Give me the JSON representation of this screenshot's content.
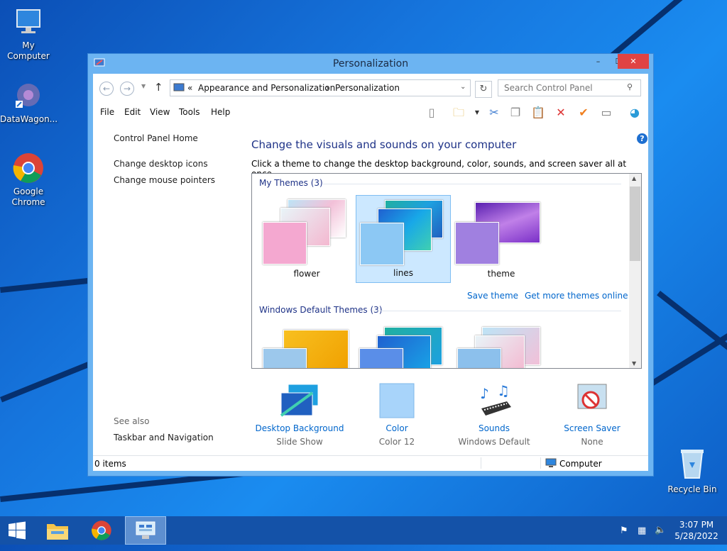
{
  "desktop": {
    "icons": [
      {
        "label": "My Computer"
      },
      {
        "label": "DataWagon..."
      },
      {
        "label": "Google Chrome"
      },
      {
        "label": "Recycle Bin"
      }
    ]
  },
  "window": {
    "title": "Personalization",
    "controls": {
      "minimize": "–",
      "maximize": "☐",
      "close": "✕"
    },
    "breadcrumb": {
      "prefix": "«",
      "part1": "Appearance and Personalization",
      "sep": "›",
      "part2": "Personalization"
    },
    "search_placeholder": "Search Control Panel",
    "menu": [
      "File",
      "Edit",
      "View",
      "Tools",
      "Help"
    ],
    "left_nav": {
      "home": "Control Panel Home",
      "link1": "Change desktop icons",
      "link2": "Change mouse pointers",
      "see_also": "See also",
      "taskbar_link": "Taskbar and Navigation"
    },
    "heading": "Change the visuals and sounds on your computer",
    "subheading": "Click a theme to change the desktop background, color, sounds, and screen saver all at once.",
    "my_themes_label": "My Themes (3)",
    "my_themes": [
      {
        "name": "flower",
        "selected": false
      },
      {
        "name": "lines",
        "selected": true
      },
      {
        "name": "theme",
        "selected": false
      }
    ],
    "save_theme": "Save theme",
    "get_more": "Get more themes online",
    "default_themes_label": "Windows Default Themes (3)",
    "bottom": [
      {
        "label": "Desktop Background",
        "value": "Slide Show"
      },
      {
        "label": "Color",
        "value": "Color 12"
      },
      {
        "label": "Sounds",
        "value": "Windows Default"
      },
      {
        "label": "Screen Saver",
        "value": "None"
      }
    ],
    "status": {
      "items": "0 items",
      "location": "Computer"
    }
  },
  "taskbar": {
    "time": "3:07 PM",
    "date": "5/28/2022"
  },
  "colors": {
    "accent": "#6cb4f2",
    "link": "#0066cc",
    "heading": "#1e3287",
    "close": "#e04343"
  }
}
